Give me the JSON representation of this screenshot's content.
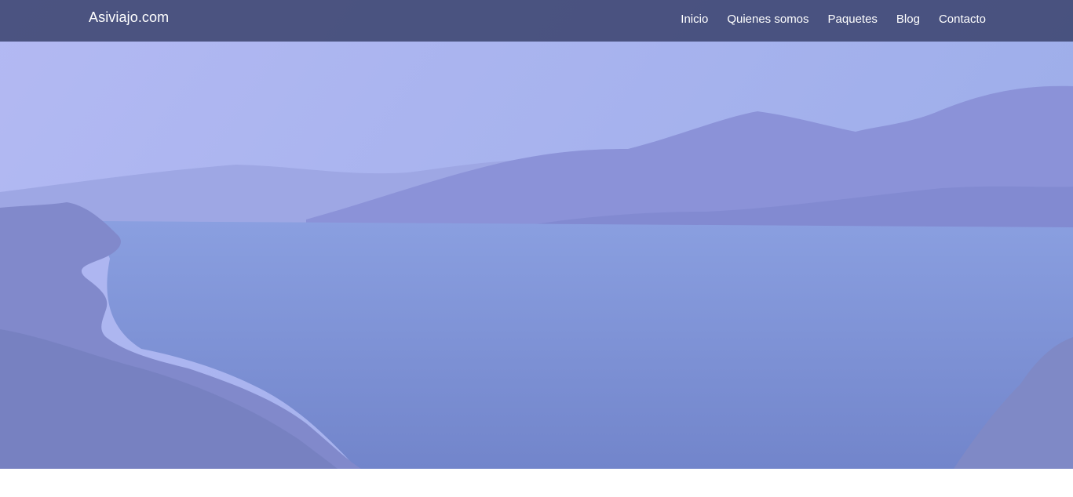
{
  "navbar": {
    "brand": "Asiviajo.com",
    "links": [
      {
        "label": "Inicio"
      },
      {
        "label": "Quienes somos"
      },
      {
        "label": "Paquetes"
      },
      {
        "label": "Blog"
      },
      {
        "label": "Contacto"
      }
    ]
  },
  "hero": {
    "image": "lake-and-mountains-landscape",
    "overlay_color": "#8c97e6"
  },
  "colors": {
    "navbar_bg": "#3a426e",
    "nav_text": "#ffffff",
    "page_bg": "#ffffff"
  }
}
